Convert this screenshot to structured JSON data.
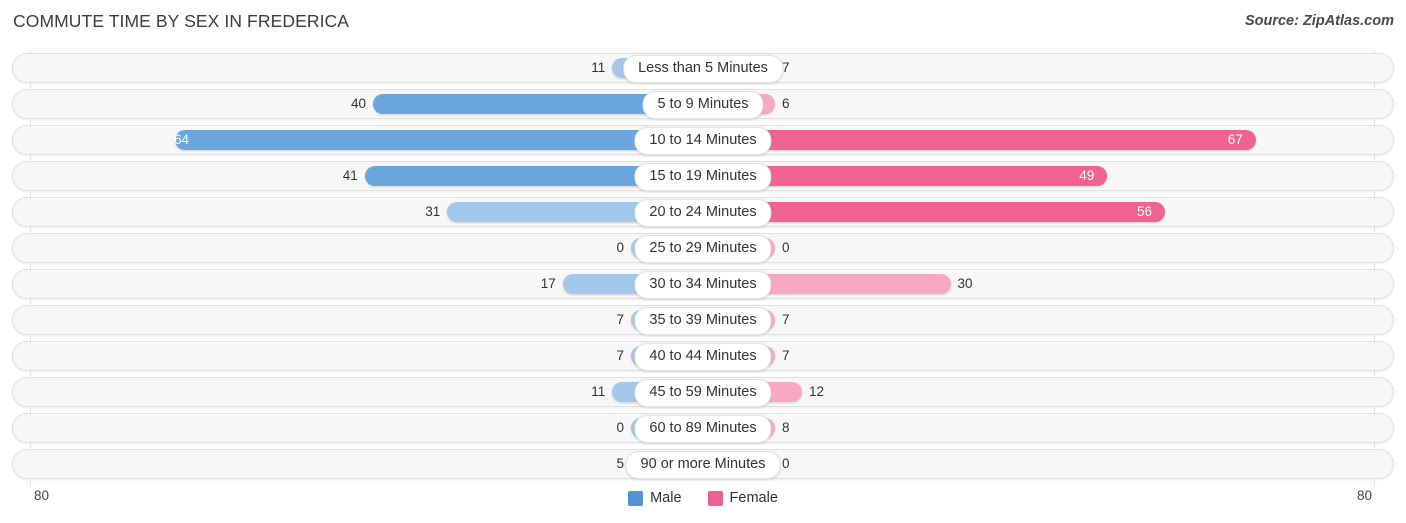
{
  "header": {
    "title": "COMMUTE TIME BY SEX IN FREDERICA",
    "source": "Source: ZipAtlas.com"
  },
  "axis": {
    "left_end_label": "80",
    "right_end_label": "80",
    "max": 80
  },
  "legend": {
    "items": [
      {
        "label": "Male",
        "color": "#4e94d6"
      },
      {
        "label": "Female",
        "color": "#ef5f93"
      }
    ]
  },
  "colors": {
    "male_strong": "#6aa6dd",
    "male_light": "#a3c8ea",
    "female_strong": "#f0628f",
    "female_light": "#f8a8c4",
    "track": "#f7f7f7",
    "track_border": "#e0e0e0",
    "gridline": "#e3e3e3"
  },
  "chart_data": {
    "type": "bar",
    "title": "COMMUTE TIME BY SEX IN FREDERICA",
    "subtitle": "Source: ZipAtlas.com",
    "orientation": "horizontal-diverging",
    "xlabel": "",
    "ylabel": "",
    "xlim": [
      -80,
      80
    ],
    "axis_max": 80,
    "grid": true,
    "legend_position": "bottom-center",
    "categories": [
      "Less than 5 Minutes",
      "5 to 9 Minutes",
      "10 to 14 Minutes",
      "15 to 19 Minutes",
      "20 to 24 Minutes",
      "25 to 29 Minutes",
      "30 to 34 Minutes",
      "35 to 39 Minutes",
      "40 to 44 Minutes",
      "45 to 59 Minutes",
      "60 to 89 Minutes",
      "90 or more Minutes"
    ],
    "series": [
      {
        "name": "Male",
        "color": "#4e94d6",
        "side": "left",
        "values": [
          11,
          40,
          64,
          41,
          31,
          0,
          17,
          7,
          7,
          11,
          0,
          5
        ]
      },
      {
        "name": "Female",
        "color": "#ef5f93",
        "side": "right",
        "values": [
          7,
          6,
          67,
          49,
          56,
          0,
          30,
          7,
          7,
          12,
          8,
          0
        ]
      }
    ]
  },
  "rows": [
    {
      "label": "Less than 5 Minutes",
      "male": "11",
      "female": "7",
      "male_value": 11,
      "female_value": 7,
      "male_inside": false,
      "female_inside": false
    },
    {
      "label": "5 to 9 Minutes",
      "male": "40",
      "female": "6",
      "male_value": 40,
      "female_value": 6,
      "male_inside": false,
      "female_inside": false
    },
    {
      "label": "10 to 14 Minutes",
      "male": "64",
      "female": "67",
      "male_value": 64,
      "female_value": 67,
      "male_inside": true,
      "female_inside": true
    },
    {
      "label": "15 to 19 Minutes",
      "male": "41",
      "female": "49",
      "male_value": 41,
      "female_value": 49,
      "male_inside": false,
      "female_inside": true
    },
    {
      "label": "20 to 24 Minutes",
      "male": "31",
      "female": "56",
      "male_value": 31,
      "female_value": 56,
      "male_inside": false,
      "female_inside": true
    },
    {
      "label": "25 to 29 Minutes",
      "male": "0",
      "female": "0",
      "male_value": 0,
      "female_value": 0,
      "male_inside": false,
      "female_inside": false
    },
    {
      "label": "30 to 34 Minutes",
      "male": "17",
      "female": "30",
      "male_value": 17,
      "female_value": 30,
      "male_inside": false,
      "female_inside": false
    },
    {
      "label": "35 to 39 Minutes",
      "male": "7",
      "female": "7",
      "male_value": 7,
      "female_value": 7,
      "male_inside": false,
      "female_inside": false
    },
    {
      "label": "40 to 44 Minutes",
      "male": "7",
      "female": "7",
      "male_value": 7,
      "female_value": 7,
      "male_inside": false,
      "female_inside": false
    },
    {
      "label": "45 to 59 Minutes",
      "male": "11",
      "female": "12",
      "male_value": 11,
      "female_value": 12,
      "male_inside": false,
      "female_inside": false
    },
    {
      "label": "60 to 89 Minutes",
      "male": "0",
      "female": "8",
      "male_value": 0,
      "female_value": 8,
      "male_inside": false,
      "female_inside": false
    },
    {
      "label": "90 or more Minutes",
      "male": "5",
      "female": "0",
      "male_value": 5,
      "female_value": 0,
      "male_inside": false,
      "female_inside": false
    }
  ]
}
